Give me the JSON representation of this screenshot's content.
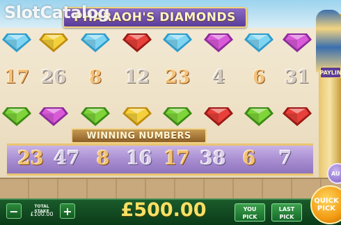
{
  "watermark": "SlotCatalog",
  "title": "PHARAOH'S DIAMONDS",
  "payline_tab": "PAYLIN",
  "gem_row_top": {
    "gems": [
      {
        "color": "#7fd4f2",
        "edge": "#2f9ccb",
        "icon": "cyan-diamond-icon"
      },
      {
        "color": "#f4d13c",
        "edge": "#c08b0d",
        "icon": "yellow-diamond-icon"
      },
      {
        "color": "#7fd4f2",
        "edge": "#2f9ccb",
        "icon": "cyan-diamond-icon"
      },
      {
        "color": "#e8403a",
        "edge": "#9b1a16",
        "icon": "red-diamond-icon"
      },
      {
        "color": "#7fd4f2",
        "edge": "#2f9ccb",
        "icon": "cyan-diamond-icon"
      },
      {
        "color": "#d95ad9",
        "edge": "#8f2a9b",
        "icon": "magenta-diamond-icon"
      },
      {
        "color": "#7fd4f2",
        "edge": "#2f9ccb",
        "icon": "cyan-diamond-icon"
      },
      {
        "color": "#d95ad9",
        "edge": "#8f2a9b",
        "icon": "magenta-diamond-icon"
      }
    ]
  },
  "number_row": {
    "numbers": [
      {
        "value": "17",
        "style": "gold"
      },
      {
        "value": "26",
        "style": "grey"
      },
      {
        "value": "8",
        "style": "gold"
      },
      {
        "value": "12",
        "style": "grey"
      },
      {
        "value": "23",
        "style": "gold"
      },
      {
        "value": "4",
        "style": "grey"
      },
      {
        "value": "6",
        "style": "gold"
      },
      {
        "value": "31",
        "style": "grey"
      }
    ]
  },
  "gem_row_bottom": {
    "gems": [
      {
        "color": "#7fd43a",
        "edge": "#3b8a14",
        "icon": "green-diamond-icon"
      },
      {
        "color": "#d95ad9",
        "edge": "#8f2a9b",
        "icon": "magenta-diamond-icon"
      },
      {
        "color": "#7fd43a",
        "edge": "#3b8a14",
        "icon": "green-diamond-icon"
      },
      {
        "color": "#f4d13c",
        "edge": "#c08b0d",
        "icon": "yellow-diamond-icon"
      },
      {
        "color": "#7fd43a",
        "edge": "#3b8a14",
        "icon": "green-diamond-icon"
      },
      {
        "color": "#e8403a",
        "edge": "#9b1a16",
        "icon": "red-diamond-icon"
      },
      {
        "color": "#7fd43a",
        "edge": "#3b8a14",
        "icon": "green-diamond-icon"
      },
      {
        "color": "#e8403a",
        "edge": "#9b1a16",
        "icon": "red-diamond-icon"
      }
    ]
  },
  "winning_numbers": {
    "label": "WINNING NUMBERS",
    "numbers": [
      {
        "value": "23",
        "style": "gold"
      },
      {
        "value": "47",
        "style": "grey"
      },
      {
        "value": "8",
        "style": "gold"
      },
      {
        "value": "16",
        "style": "grey"
      },
      {
        "value": "17",
        "style": "gold"
      },
      {
        "value": "38",
        "style": "grey"
      },
      {
        "value": "6",
        "style": "gold"
      },
      {
        "value": "7",
        "style": "grey"
      }
    ]
  },
  "controls": {
    "minus": "−",
    "plus": "+",
    "stake_label": "TOTAL STAKE",
    "stake_value": "£100.00",
    "amount": "£500.00",
    "you_pick": "YOU PICK",
    "last_pick": "LAST PICK",
    "quick_pick": "QUICK PICK",
    "auto": "AU"
  }
}
